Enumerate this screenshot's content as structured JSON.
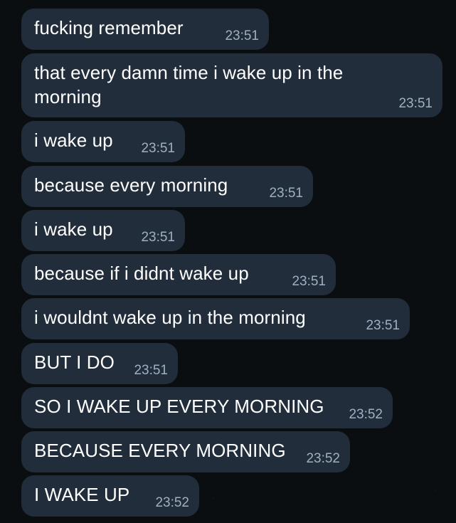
{
  "messages": [
    {
      "text": "fucking remember",
      "time": "23:51"
    },
    {
      "text": "that every damn time i wake up in the morning",
      "time": "23:51"
    },
    {
      "text": "i wake up",
      "time": "23:51"
    },
    {
      "text": "because every morning",
      "time": "23:51"
    },
    {
      "text": "i wake up",
      "time": "23:51"
    },
    {
      "text": "because if i didnt wake up",
      "time": "23:51"
    },
    {
      "text": "i wouldnt wake up in the morning",
      "time": "23:51"
    },
    {
      "text": "BUT I DO",
      "time": "23:51"
    },
    {
      "text": "SO I WAKE UP EVERY MORNING",
      "time": "23:52"
    },
    {
      "text": "BECAUSE EVERY MORNING",
      "time": "23:52"
    },
    {
      "text": "I WAKE UP",
      "time": "23:52"
    }
  ]
}
